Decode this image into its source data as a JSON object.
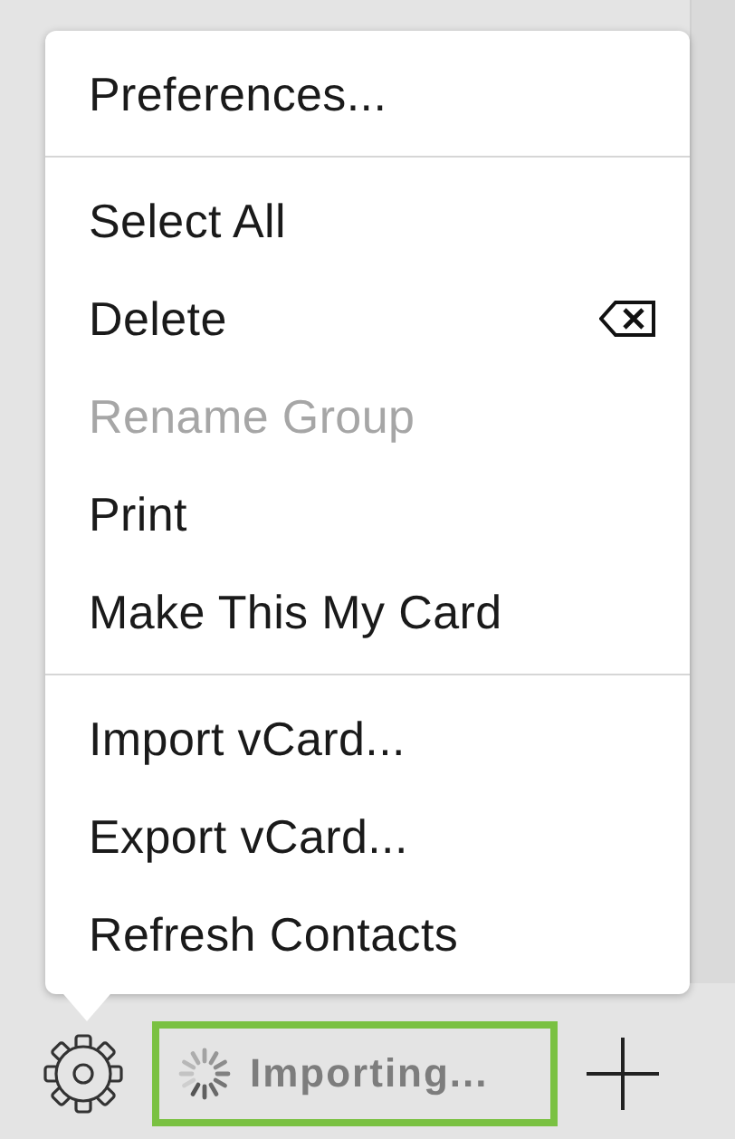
{
  "menu": {
    "sections": [
      {
        "items": [
          {
            "label": "Preferences...",
            "disabled": false,
            "kind": "plain"
          }
        ]
      },
      {
        "items": [
          {
            "label": "Select All",
            "disabled": false,
            "kind": "plain"
          },
          {
            "label": "Delete",
            "disabled": false,
            "kind": "delete"
          },
          {
            "label": "Rename Group",
            "disabled": true,
            "kind": "plain"
          },
          {
            "label": "Print",
            "disabled": false,
            "kind": "plain"
          },
          {
            "label": "Make This My Card",
            "disabled": false,
            "kind": "plain"
          }
        ]
      },
      {
        "items": [
          {
            "label": "Import vCard...",
            "disabled": false,
            "kind": "plain"
          },
          {
            "label": "Export vCard...",
            "disabled": false,
            "kind": "plain"
          },
          {
            "label": "Refresh Contacts",
            "disabled": false,
            "kind": "plain"
          }
        ]
      }
    ]
  },
  "status": {
    "text": "Importing...",
    "highlighted": true
  }
}
